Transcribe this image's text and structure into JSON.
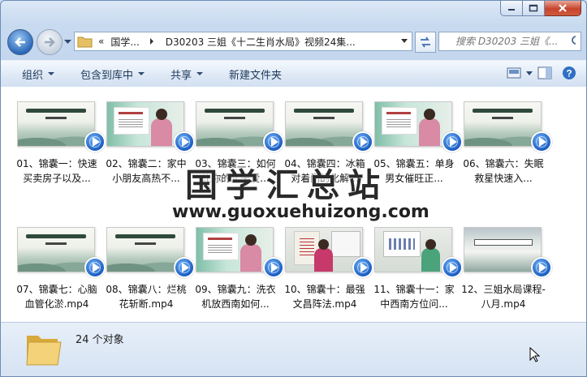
{
  "address": {
    "chevrons": "«",
    "crumb1": "国学...",
    "crumb2": "D30203 三姐《十二生肖水局》视频24集..."
  },
  "search": {
    "placeholder": "搜索 D30203 三姐《..."
  },
  "toolbar": {
    "organize": "组织",
    "include_library": "包含到库中",
    "share": "共享",
    "new_folder": "新建文件夹"
  },
  "files": [
    {
      "name": "01、锦囊一：快速买卖房子以及...",
      "thumb": "brush"
    },
    {
      "name": "02、锦囊二：家中小朋友高热不...",
      "thumb": "person"
    },
    {
      "name": "03、锦囊三：如何让你的丈夫爱...",
      "thumb": "brush"
    },
    {
      "name": "04、锦囊四：冰箱对着门的化解...",
      "thumb": "brush"
    },
    {
      "name": "05、锦囊五：单身男女催旺正...",
      "thumb": "person"
    },
    {
      "name": "06、锦囊六：失眠救星快速入...",
      "thumb": "brush"
    },
    {
      "name": "07、锦囊七：心脑血管化淤.mp4",
      "thumb": "brush"
    },
    {
      "name": "08、锦囊八：烂桃花斩断.mp4",
      "thumb": "brush"
    },
    {
      "name": "09、锦囊九：洗衣机放西南如何...",
      "thumb": "person"
    },
    {
      "name": "10、锦囊十：最强文昌阵法.mp4",
      "thumb": "studio"
    },
    {
      "name": "11、锦囊十一：家中西南方位问...",
      "thumb": "studio2"
    },
    {
      "name": "12、三姐水局课程-八月.mp4",
      "thumb": "scroll"
    }
  ],
  "status": {
    "count": "24 个对象"
  },
  "watermark": {
    "text": "国学汇总站",
    "url": "www.guoxuehuizong.com"
  }
}
